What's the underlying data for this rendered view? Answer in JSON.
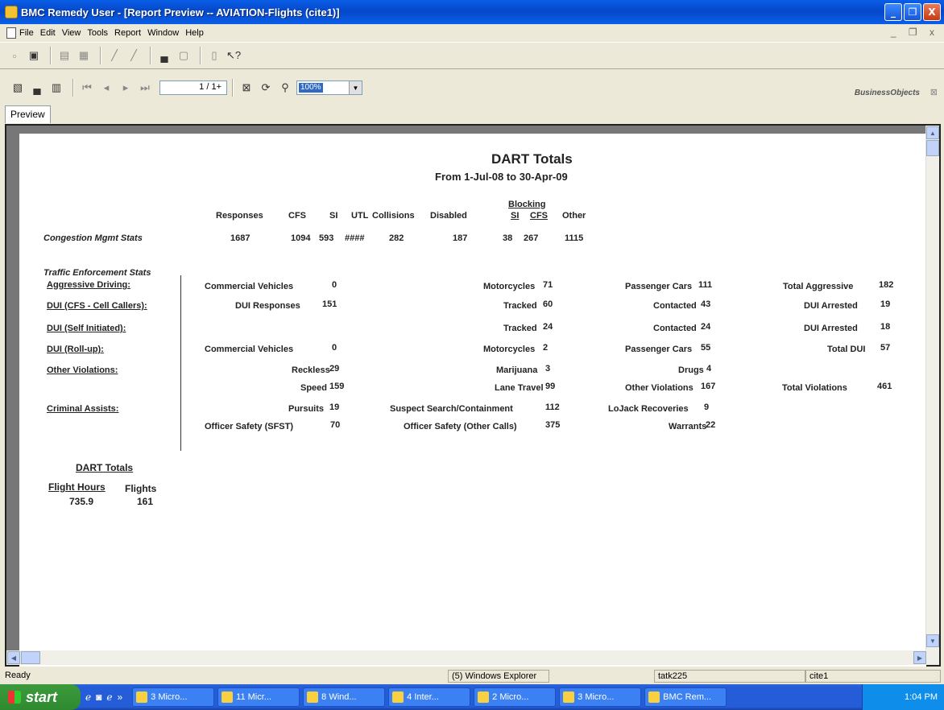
{
  "window": {
    "title": "BMC Remedy User - [Report Preview -- AVIATION-Flights (cite1)]",
    "controls": [
      "_",
      "❐",
      "X"
    ]
  },
  "menu": [
    "File",
    "Edit",
    "View",
    "Tools",
    "Report",
    "Window",
    "Help"
  ],
  "mdi_controls": "_ ❐ x",
  "toolbar2": {
    "page_display": "1 / 1+",
    "zoom": "100%",
    "brand": "BusinessObjects"
  },
  "tab": "Preview",
  "report": {
    "title": "DART Totals",
    "subtitle": "From 1-Jul-08 to 30-Apr-09",
    "blocking_header": "Blocking",
    "columns": [
      "Responses",
      "CFS",
      "SI",
      "UTL",
      "Collisions",
      "Disabled",
      "SI",
      "CFS",
      "Other"
    ],
    "congestion_label": "Congestion Mgmt Stats",
    "congestion_values": [
      "1687",
      "1094",
      "593",
      "####",
      "282",
      "187",
      "38",
      "267",
      "1115"
    ],
    "traffic_label": "Traffic Enforcement Stats",
    "rows": {
      "aggressive": {
        "label": "Aggressive Driving:",
        "a_label": "Commercial Vehicles",
        "a_value": "0",
        "b_label": "Motorcycles",
        "b_value": "71",
        "c_label": "Passenger Cars",
        "c_value": "111",
        "d_label": "Total Aggressive",
        "d_value": "182"
      },
      "dui_cfs": {
        "label": "DUI (CFS - Cell Callers):",
        "a_label": "DUI Responses",
        "a_value": "151",
        "b_label": "Tracked",
        "b_value": "60",
        "c_label": "Contacted",
        "c_value": "43",
        "d_label": "DUI Arrested",
        "d_value": "19"
      },
      "dui_self": {
        "label": "DUI (Self Initiated):",
        "b_label": "Tracked",
        "b_value": "24",
        "c_label": "Contacted",
        "c_value": "24",
        "d_label": "DUI Arrested",
        "d_value": "18"
      },
      "dui_rollup": {
        "label": "DUI (Roll-up):",
        "a_label": "Commercial Vehicles",
        "a_value": "0",
        "b_label": "Motorcycles",
        "b_value": "2",
        "c_label": "Passenger Cars",
        "c_value": "55",
        "d_label": "Total DUI",
        "d_value": "57"
      },
      "other1": {
        "label": "Other Violations:",
        "a_label": "Reckless",
        "a_value": "29",
        "b_label": "Marijuana",
        "b_value": "3",
        "c_label": "Drugs",
        "c_value": "4"
      },
      "other2": {
        "a_label": "Speed",
        "a_value": "159",
        "b_label": "Lane Travel",
        "b_value": "99",
        "c_label": "Other Violations",
        "c_value": "167",
        "d_label": "Total Violations",
        "d_value": "461"
      },
      "criminal1": {
        "label": "Criminal Assists:",
        "a_label": "Pursuits",
        "a_value": "19",
        "b_label": "Suspect Search/Containment",
        "b_value": "112",
        "c_label": "LoJack Recoveries",
        "c_value": "9"
      },
      "criminal2": {
        "a_label": "Officer Safety (SFST)",
        "a_value": "70",
        "b_label": "Officer Safety (Other Calls)",
        "b_value": "375",
        "c_label": "Warrants",
        "c_value": "22"
      }
    },
    "dart": {
      "header": "DART Totals",
      "flight_hours_label": "Flight Hours",
      "flights_label": "Flights",
      "flight_hours": "735.9",
      "flights": "161"
    }
  },
  "status": {
    "ready": "Ready",
    "explorer": "(5) Windows Explorer",
    "user": "tatk225",
    "db": "cite1"
  },
  "taskbar": {
    "start": "start",
    "buttons": [
      "3 Micro...",
      "11 Micr...",
      "8 Wind...",
      "4 Inter...",
      "2 Micro...",
      "3 Micro...",
      "BMC Rem..."
    ],
    "clock": "1:04 PM"
  }
}
